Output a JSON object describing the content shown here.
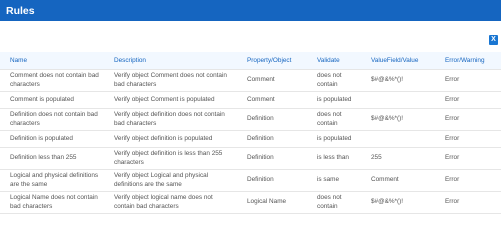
{
  "header": {
    "title": "Rules"
  },
  "toolbar": {
    "export_icon_label": "X"
  },
  "table": {
    "columns": [
      "Name",
      "Description",
      "Property/Object",
      "Validate",
      "ValueField/Value",
      "Error/Warning"
    ],
    "rows": [
      [
        "Comment does not contain bad characters",
        "Verify object Comment does not contain bad characters",
        "Comment",
        "does not contain",
        "$#@&%*()!",
        "Error"
      ],
      [
        "Comment is populated",
        "Verify object Comment is populated",
        "Comment",
        "is populated",
        "",
        "Error"
      ],
      [
        "Definition does not contain bad characters",
        "Verify object definition does not contain bad characters",
        "Definition",
        "does not contain",
        "$#@&%*()!",
        "Error"
      ],
      [
        "Definition is populated",
        "Verify object definition is populated",
        "Definition",
        "is populated",
        "",
        "Error"
      ],
      [
        "Definition less than 255",
        "Verify object definition is less than 255 characters",
        "Definition",
        "is less than",
        "255",
        "Error"
      ],
      [
        "Logical and physical definitions are the same",
        "Verify object Logical and physical definitions are the same",
        "Definition",
        "is same",
        "Comment",
        "Error"
      ],
      [
        "Logical Name does not contain bad characters",
        "Verify object logical name does not contain bad characters",
        "Logical Name",
        "does not contain",
        "$#@&%*()!",
        "Error"
      ]
    ]
  }
}
